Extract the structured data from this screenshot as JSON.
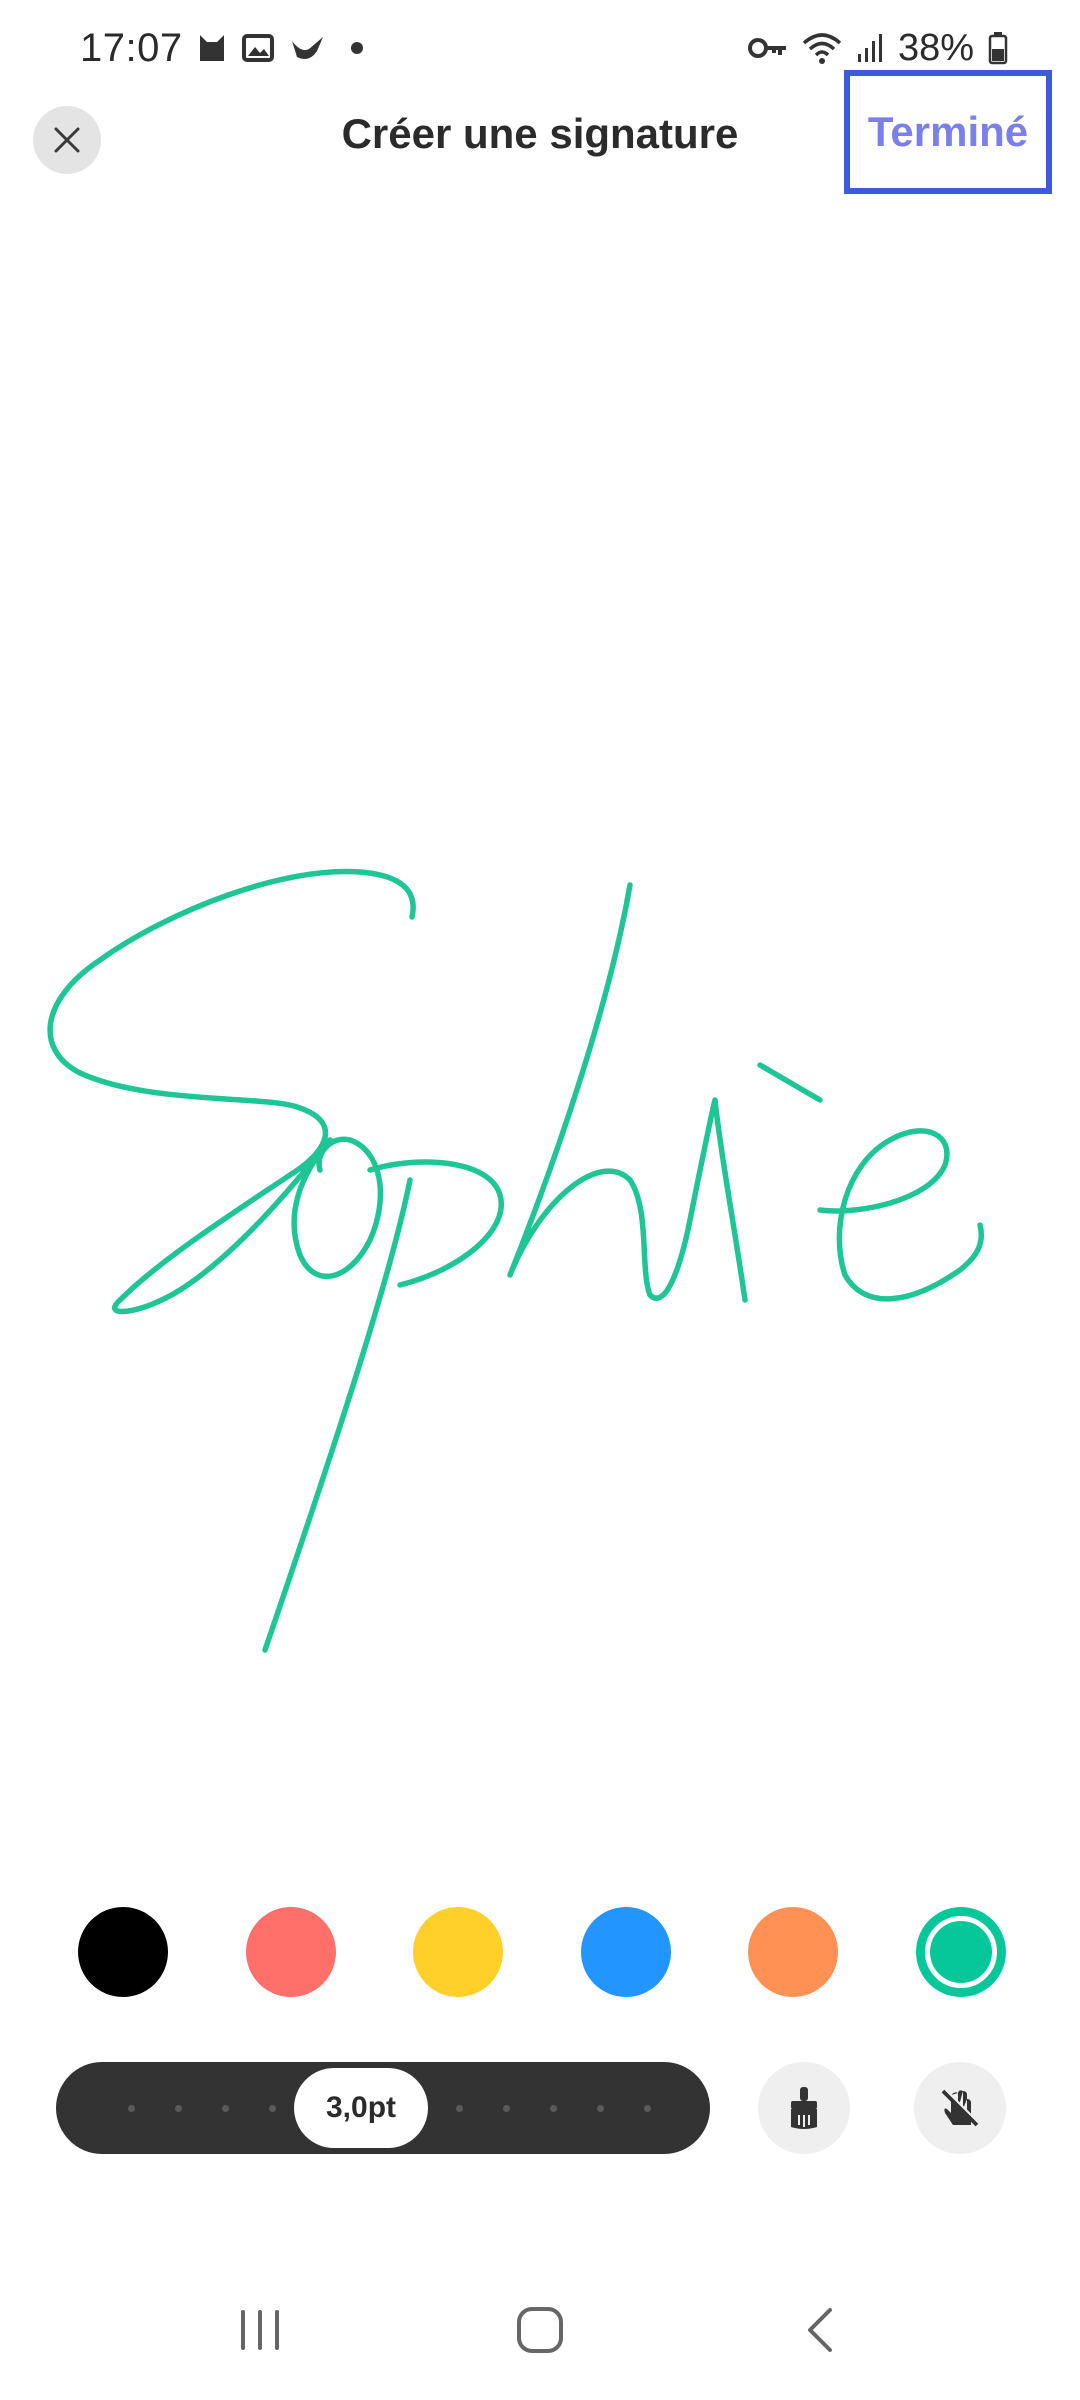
{
  "status_bar": {
    "time": "17:07",
    "battery_percent": "38%",
    "left_icons": [
      "cat-icon",
      "image-icon",
      "bird-icon",
      "notification-dot-icon"
    ],
    "right_icons": [
      "vpn-key-icon",
      "wifi-icon",
      "signal-icon",
      "battery-icon"
    ]
  },
  "header": {
    "title": "Créer une signature",
    "done_label": "Terminé"
  },
  "signature": {
    "text": "Sophie",
    "stroke_color": "#1fc595"
  },
  "palette": {
    "colors": [
      "#000000",
      "#ff706b",
      "#ffd02a",
      "#2295ff",
      "#ff9155",
      "#05c79a"
    ],
    "selected_index": 5
  },
  "stroke": {
    "value_label": "3,0pt"
  },
  "tools": {
    "brush_icon": "brush-icon",
    "palm_rejection_icon": "hand-off-icon"
  },
  "nav": {
    "icons": [
      "recent-apps-icon",
      "home-icon",
      "back-icon"
    ]
  }
}
